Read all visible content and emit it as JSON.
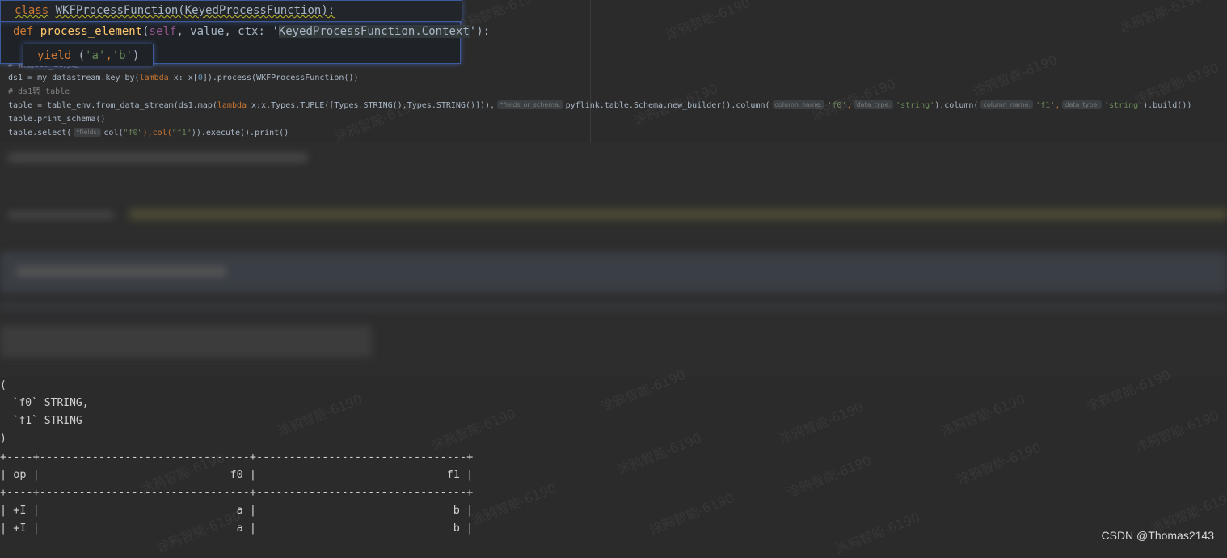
{
  "editor": {
    "line_comment_top": "# 根据dev_id分组",
    "line_ds1": {
      "prefix": "ds1 = my_datastream.key_by(",
      "lambda": "lambda",
      "mid": " x: x[",
      "num": "0",
      "suffix": "]).process(WKFProcessFunction())"
    },
    "line_comment2": "# ds1转 table",
    "line_table": {
      "a": "table = table_env.from_data_stream(ds1.map(",
      "lambda": "lambda",
      "b": " x:x,Types.TUPLE([Types.STRING(),Types.STRING()])),",
      "hint1": "*fields_or_schema:",
      "c": "pyflink.table.Schema.new_builder().column(",
      "hint2": "column_name:",
      "s1": "'f0'",
      "comma1": ",",
      "hint3": "data_type:",
      "s2": "'string'",
      "d": ").column(",
      "hint4": "column_name:",
      "s3": "'f1'",
      "comma2": ",",
      "hint5": "data_type:",
      "s4": "'string'",
      "e": ").build())"
    },
    "line_print_schema": "table.print_schema()",
    "line_select": {
      "a": "table.select(",
      "hint": "*fields:",
      "b": "col(",
      "s1": "\"f0\"",
      "c": "),col(",
      "s2": "\"f1\"",
      "d": ")).execute().print()"
    }
  },
  "popups": {
    "class_line": {
      "kw": "class",
      "name": "WKFProcessFunction(KeyedProcessFunction):"
    },
    "def_line": {
      "kw": "def",
      "fn": "process_element",
      "open": "(",
      "self": "self",
      "mid": ", value, ctx: '",
      "ctx": "KeyedProcessFunction.Context",
      "close": "'):"
    },
    "yield_line": {
      "kw": "yield",
      "open": " (",
      "s1": "'a'",
      "comma": ",",
      "s2": "'b'",
      "close": ")"
    }
  },
  "console": {
    "schema_lines": [
      "(",
      "  `f0` STRING,",
      "  `f1` STRING",
      ")"
    ],
    "table_lines": [
      "+----+--------------------------------+--------------------------------+",
      "| op |                             f0 |                             f1 |",
      "+----+--------------------------------+--------------------------------+",
      "| +I |                              a |                              b |",
      "| +I |                              a |                              b |"
    ]
  },
  "watermark_text": "涂鸦智能-6190",
  "footer": {
    "credit": "CSDN @Thomas2143"
  }
}
